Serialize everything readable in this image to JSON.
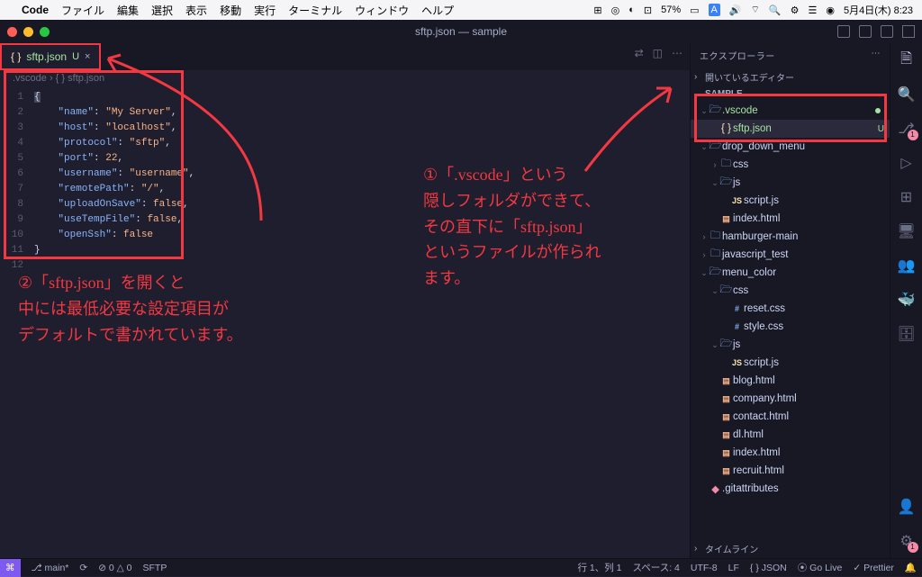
{
  "menubar": {
    "apple": "",
    "app": "Code",
    "items": [
      "ファイル",
      "編集",
      "選択",
      "表示",
      "移動",
      "実行",
      "ターミナル",
      "ウィンドウ",
      "ヘルプ"
    ],
    "battery": "57%",
    "clock": "5月4日(木) 8:23"
  },
  "titlebar": {
    "title": "sftp.json — sample"
  },
  "tab": {
    "icon": "{ }",
    "filename": "sftp.json",
    "status": "U",
    "close": "×"
  },
  "breadcrumb": ".vscode › { } sftp.json",
  "editor": {
    "lines": [
      "1",
      "2",
      "3",
      "4",
      "5",
      "6",
      "7",
      "8",
      "9",
      "10",
      "11",
      "12"
    ],
    "code_rows": [
      {
        "t": "punc",
        "txt": "{"
      },
      {
        "t": "kv",
        "key": "\"name\"",
        "val": "\"My Server\"",
        "str": true,
        "comma": true
      },
      {
        "t": "kv",
        "key": "\"host\"",
        "val": "\"localhost\"",
        "str": true,
        "comma": true
      },
      {
        "t": "kv",
        "key": "\"protocol\"",
        "val": "\"sftp\"",
        "str": true,
        "comma": true
      },
      {
        "t": "kv",
        "key": "\"port\"",
        "val": "22",
        "str": false,
        "comma": true
      },
      {
        "t": "kv",
        "key": "\"username\"",
        "val": "\"username\"",
        "str": true,
        "comma": true
      },
      {
        "t": "kv",
        "key": "\"remotePath\"",
        "val": "\"/\"",
        "str": true,
        "comma": true
      },
      {
        "t": "kv",
        "key": "\"uploadOnSave\"",
        "val": "false",
        "str": false,
        "comma": true
      },
      {
        "t": "kv",
        "key": "\"useTempFile\"",
        "val": "false",
        "str": false,
        "comma": true
      },
      {
        "t": "kv",
        "key": "\"openSsh\"",
        "val": "false",
        "str": false,
        "comma": false
      },
      {
        "t": "punc",
        "txt": "}"
      },
      {
        "t": "blank"
      }
    ]
  },
  "explorer": {
    "title": "エクスプローラー",
    "openEditors": "開いているエディター",
    "root": "SAMPLE",
    "timeline": "タイムライン",
    "tree": [
      {
        "depth": 0,
        "twist": "v",
        "icon": "folder-open",
        "label": ".vscode",
        "mod": true,
        "dot": true
      },
      {
        "depth": 1,
        "twist": "",
        "icon": "json",
        "label": "sftp.json",
        "mod": true,
        "u": "U",
        "active": true
      },
      {
        "depth": 0,
        "twist": "v",
        "icon": "folder-open",
        "label": "drop_down_menu"
      },
      {
        "depth": 1,
        "twist": ">",
        "icon": "folder",
        "label": "css"
      },
      {
        "depth": 1,
        "twist": "v",
        "icon": "folder-open",
        "label": "js"
      },
      {
        "depth": 2,
        "twist": "",
        "icon": "js",
        "label": "script.js"
      },
      {
        "depth": 1,
        "twist": "",
        "icon": "html",
        "label": "index.html"
      },
      {
        "depth": 0,
        "twist": ">",
        "icon": "folder",
        "label": "hamburger-main"
      },
      {
        "depth": 0,
        "twist": ">",
        "icon": "folder",
        "label": "javascript_test"
      },
      {
        "depth": 0,
        "twist": "v",
        "icon": "folder-open",
        "label": "menu_color"
      },
      {
        "depth": 1,
        "twist": "v",
        "icon": "folder-open",
        "label": "css"
      },
      {
        "depth": 2,
        "twist": "",
        "icon": "css",
        "label": "reset.css"
      },
      {
        "depth": 2,
        "twist": "",
        "icon": "css",
        "label": "style.css"
      },
      {
        "depth": 1,
        "twist": "v",
        "icon": "folder-open",
        "label": "js"
      },
      {
        "depth": 2,
        "twist": "",
        "icon": "js",
        "label": "script.js"
      },
      {
        "depth": 1,
        "twist": "",
        "icon": "html",
        "label": "blog.html"
      },
      {
        "depth": 1,
        "twist": "",
        "icon": "html",
        "label": "company.html"
      },
      {
        "depth": 1,
        "twist": "",
        "icon": "html",
        "label": "contact.html"
      },
      {
        "depth": 1,
        "twist": "",
        "icon": "html",
        "label": "dl.html"
      },
      {
        "depth": 1,
        "twist": "",
        "icon": "html",
        "label": "index.html"
      },
      {
        "depth": 1,
        "twist": "",
        "icon": "html",
        "label": "recruit.html"
      },
      {
        "depth": 0,
        "twist": "",
        "icon": "git",
        "label": ".gitattributes"
      }
    ]
  },
  "activity": {
    "scm_badge": "1",
    "bottom_badge": "1"
  },
  "status": {
    "remote": "⌘",
    "branch": "main*",
    "sync": "⟳",
    "problems": "⊘ 0 △ 0",
    "sftp": "SFTP",
    "cursor": "行 1、列 1",
    "spaces": "スペース: 4",
    "encoding": "UTF-8",
    "eol": "LF",
    "lang": "{ } JSON",
    "golive": "⦿ Go Live",
    "prettier": "✓ Prettier",
    "bell": "🔔"
  },
  "annot": {
    "a1": "①「.vscode」という\n隠しフォルダができて、\nその直下に「sftp.json」\nというファイルが作られ\nます。",
    "a2": "②「sftp.json」を開くと\n中には最低必要な設定項目が\nデフォルトで書かれています。"
  }
}
